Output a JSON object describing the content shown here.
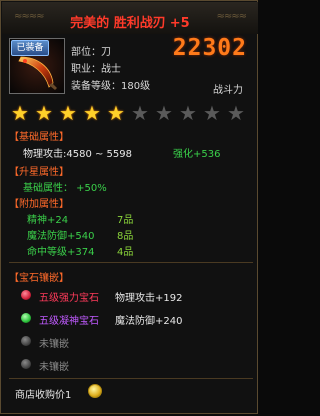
{
  "title": {
    "name": "完美的 胜利战刃",
    "enhance": "+5"
  },
  "item": {
    "equipped_badge": "已装备",
    "slot": "部位：刀",
    "job": "职业：战士",
    "level": "装备等级：180级"
  },
  "power": {
    "value": "22302",
    "label": "战斗力"
  },
  "stars": {
    "filled": 5,
    "total": 10
  },
  "basic": {
    "header": "【基础属性】",
    "physical_attack": "物理攻击:4580 ~ 5598",
    "strengthen": "强化+536"
  },
  "upgrade": {
    "header": "【升星属性】",
    "line": "基础属性： +50%"
  },
  "extra": {
    "header": "【附加属性】",
    "rows": [
      {
        "attr": "精神+24",
        "grade": "7品"
      },
      {
        "attr": "魔法防御+540",
        "grade": "8品"
      },
      {
        "attr": "命中等级+374",
        "grade": "4品"
      }
    ]
  },
  "gems": {
    "header": "【宝石镶嵌】",
    "slots": [
      {
        "name": "五级强力宝石",
        "attr": "物理攻击+192",
        "color": "#d0203a",
        "filled": true
      },
      {
        "name": "五级凝神宝石",
        "attr": "魔法防御+240",
        "color": "#2ac03a",
        "filled": true
      },
      {
        "name": "未镶嵌",
        "attr": "",
        "color": "#5a5a5a",
        "filled": false
      },
      {
        "name": "未镶嵌",
        "attr": "",
        "color": "#5a5a5a",
        "filled": false
      }
    ]
  },
  "price": {
    "label": "商店收购价1"
  }
}
